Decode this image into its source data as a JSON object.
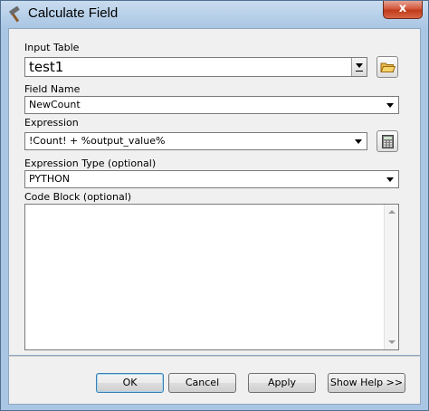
{
  "window": {
    "title": "Calculate Field",
    "title_icon": "hammer-icon",
    "close_label": "x"
  },
  "form": {
    "input_table": {
      "label": "Input Table",
      "value": "test1"
    },
    "field_name": {
      "label": "Field Name",
      "value": "NewCount"
    },
    "expression": {
      "label": "Expression",
      "value": "!Count! + %output_value%"
    },
    "expression_type": {
      "label": "Expression Type (optional)",
      "value": "PYTHON"
    },
    "code_block": {
      "label": "Code Block (optional)",
      "value": ""
    }
  },
  "buttons": {
    "ok": "OK",
    "cancel": "Cancel",
    "apply": "Apply",
    "show_help": "Show Help >>"
  },
  "colors": {
    "titlebar": "#a9c6e4",
    "close_button": "#c74425",
    "dialog_background": "#f0f0f0"
  }
}
